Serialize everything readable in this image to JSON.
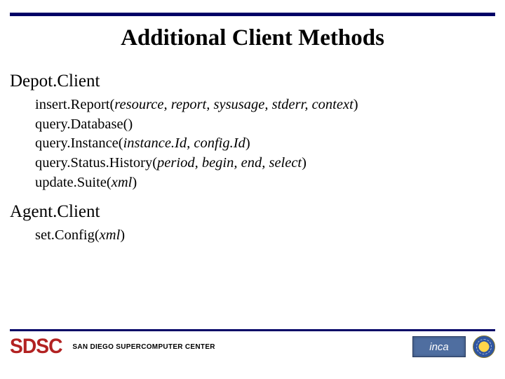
{
  "title": "Additional Client Methods",
  "sections": [
    {
      "heading": "Depot.Client",
      "methods": [
        {
          "name": "insert.Report",
          "params": "resource, report, sysusage, stderr, context"
        },
        {
          "name": "query.Database",
          "params": ""
        },
        {
          "name": "query.Instance",
          "params": "instance.Id, config.Id"
        },
        {
          "name": "query.Status.History",
          "params": "period, begin, end, select"
        },
        {
          "name": "update.Suite",
          "params": "xml"
        }
      ]
    },
    {
      "heading": "Agent.Client",
      "methods": [
        {
          "name": "set.Config",
          "params": "xml"
        }
      ]
    }
  ],
  "footer": {
    "org": "SAN DIEGO SUPERCOMPUTER CENTER",
    "sdsc_wordmark": "SDSC",
    "inca_label": "inca"
  }
}
